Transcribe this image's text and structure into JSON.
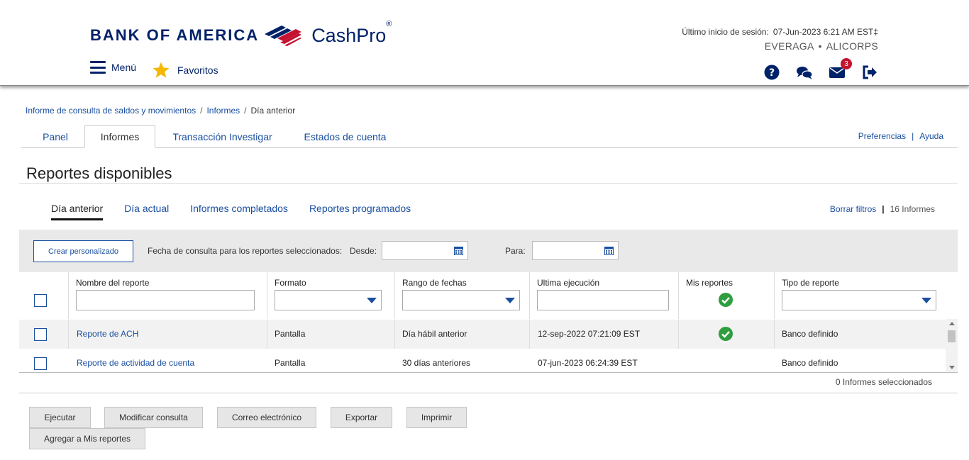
{
  "brand": {
    "logo_text": "BANK OF AMERICA",
    "product": "CashPro",
    "registered": "®",
    "colors": {
      "navy": "#012169",
      "red": "#c41230",
      "link": "#1a4fa0",
      "ok_green": "#2e9e3f",
      "star": "#f5b800"
    }
  },
  "header": {
    "menu_label": "Menú",
    "favorites_label": "Favoritos",
    "session_label": "Último inicio de sesión:",
    "session_value": "07-Jun-2023 6:21 AM EST‡",
    "company_user": "EVERAGA",
    "company_dot": "•",
    "company_name": "ALICORPS",
    "icons": [
      "help-icon",
      "chat-icon",
      "mail-icon",
      "logout-icon"
    ],
    "mail_badge": "3"
  },
  "breadcrumb": {
    "items": [
      "Informe de consulta de saldos y movimientos",
      "Informes",
      "Día anterior"
    ],
    "separator": "/"
  },
  "tabs": {
    "items": [
      "Panel",
      "Informes",
      "Transacción Investigar",
      "Estados de cuenta"
    ],
    "active": "Informes",
    "preferences": "Preferencias",
    "help": "Ayuda",
    "pipe": "|"
  },
  "page": {
    "title": "Reportes disponibles"
  },
  "subtabs": {
    "items": [
      "Día anterior",
      "Día actual",
      "Informes completados",
      "Reportes programados"
    ],
    "active": "Día anterior",
    "clear_filters": "Borrar filtros",
    "pipe": "|",
    "count": "16 Informes"
  },
  "filters": {
    "create_custom": "Crear personalizado",
    "query_date_label": "Fecha de consulta para los reportes seleccionados:",
    "from_label": "Desde:",
    "from_value": "",
    "to_label": "Para:",
    "to_value": ""
  },
  "grid": {
    "headers": [
      "Nombre del reporte",
      "Formato",
      "Rango de fechas",
      "Ultima ejecución",
      "Mis reportes",
      "Tipo de reporte"
    ],
    "rows": [
      {
        "name": "Reporte de ACH",
        "format": "Pantalla",
        "range": "Día hábil anterior",
        "last_run": "12-sep-2022 07:21:09 EST",
        "mine": true,
        "type": "Banco definido"
      },
      {
        "name": "Reporte de actividad de cuenta",
        "format": "Pantalla",
        "range": "30 días anteriores",
        "last_run": "07-jun-2023 06:24:39 EST",
        "mine": false,
        "type": "Banco definido"
      }
    ],
    "selected_count": "0 Informes seleccionados"
  },
  "actions": {
    "run": "Ejecutar",
    "modify": "Modificar consulta",
    "email": "Correo electrónico",
    "export": "Exportar",
    "print": "Imprimir",
    "add_favorites": "Agregar a Mis reportes"
  }
}
